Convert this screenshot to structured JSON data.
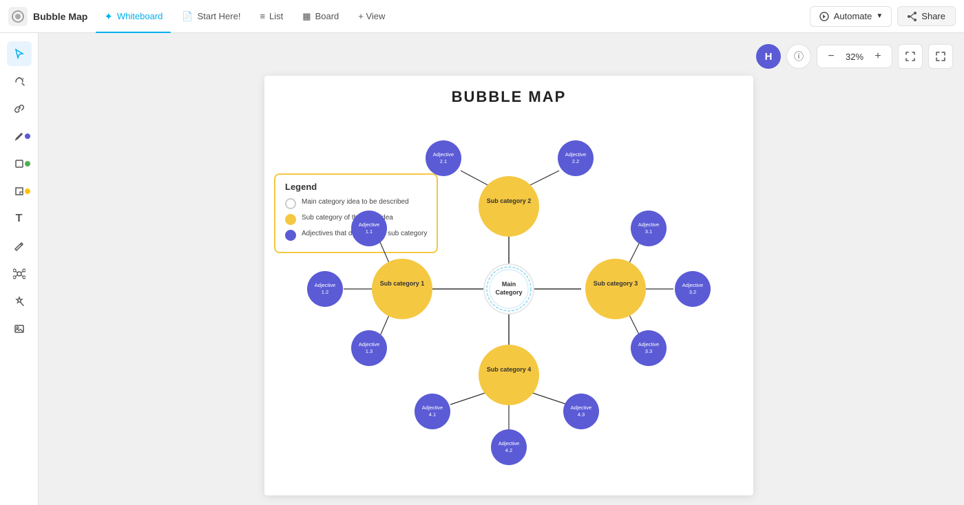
{
  "app": {
    "logo_icon": "⬛",
    "logo_text": "Bubble Map"
  },
  "nav": {
    "tabs": [
      {
        "id": "whiteboard",
        "label": "Whiteboard",
        "icon": "✦",
        "active": true
      },
      {
        "id": "start-here",
        "label": "Start Here!",
        "icon": "📄",
        "active": false
      },
      {
        "id": "list",
        "label": "List",
        "icon": "≡",
        "active": false
      },
      {
        "id": "board",
        "label": "Board",
        "icon": "▦",
        "active": false
      },
      {
        "id": "view",
        "label": "+ View",
        "icon": "",
        "active": false
      }
    ],
    "automate_label": "Automate",
    "share_label": "Share"
  },
  "canvas_controls": {
    "avatar": "H",
    "zoom": "32%",
    "zoom_in": "+",
    "zoom_out": "−"
  },
  "bubble_map": {
    "title": "BUBBLE MAP",
    "main_category": "Main\nCategory",
    "sub_categories": [
      "Sub category 1",
      "Sub category 2",
      "Sub category 3",
      "Sub category 4"
    ],
    "adjectives": [
      {
        "label": "Adjective\n1.1",
        "sub": 1
      },
      {
        "label": "Adjective\n1.2",
        "sub": 1
      },
      {
        "label": "Adjective\n1.3",
        "sub": 1
      },
      {
        "label": "Adjective\n2.1",
        "sub": 2
      },
      {
        "label": "Adjective\n2.2",
        "sub": 2
      },
      {
        "label": "Adjective\n3.1",
        "sub": 3
      },
      {
        "label": "Adjective\n3.2",
        "sub": 3
      },
      {
        "label": "Adjective\n3.3",
        "sub": 3
      },
      {
        "label": "Adjective\n4.1",
        "sub": 4
      },
      {
        "label": "Adjective\n4.2",
        "sub": 4
      },
      {
        "label": "Adjective\n4.3",
        "sub": 4
      }
    ]
  },
  "legend": {
    "title": "Legend",
    "items": [
      {
        "color": "white",
        "text": "Main category idea to be described"
      },
      {
        "color": "yellow",
        "text": "Sub category of the main idea"
      },
      {
        "color": "purple",
        "text": "Adjectives that describe the sub category"
      }
    ]
  },
  "tools": [
    {
      "id": "select",
      "icon": "↖",
      "active": true
    },
    {
      "id": "draw-plus",
      "icon": "✦",
      "active": false
    },
    {
      "id": "link",
      "icon": "🔗",
      "active": false
    },
    {
      "id": "pen",
      "icon": "✏",
      "active": false,
      "dot": "blue"
    },
    {
      "id": "shape",
      "icon": "□",
      "active": false,
      "dot": "green"
    },
    {
      "id": "note",
      "icon": "📝",
      "active": false,
      "dot": "yellow"
    },
    {
      "id": "text",
      "icon": "T",
      "active": false
    },
    {
      "id": "markup",
      "icon": "✒",
      "active": false
    },
    {
      "id": "mindmap",
      "icon": "⊕",
      "active": false
    },
    {
      "id": "magic",
      "icon": "✦",
      "active": false
    },
    {
      "id": "media",
      "icon": "🖼",
      "active": false
    }
  ]
}
